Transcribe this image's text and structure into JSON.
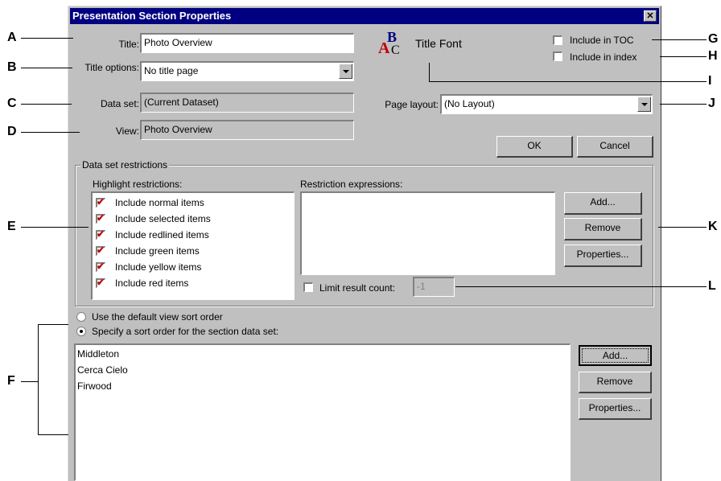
{
  "dialog": {
    "title": "Presentation Section Properties",
    "close_glyph": "✕",
    "title_label": "Title:",
    "title_value": "Photo Overview",
    "title_options_label": "Title options:",
    "title_options_value": "No title page",
    "dataset_label": "Data set:",
    "dataset_value": "(Current Dataset)",
    "view_label": "View:",
    "view_value": "Photo Overview",
    "title_font_label": "Title Font",
    "include_toc_label": "Include in TOC",
    "include_index_label": "Include in index",
    "page_layout_label": "Page layout:",
    "page_layout_value": "(No Layout)",
    "ok_label": "OK",
    "cancel_label": "Cancel"
  },
  "restrictions": {
    "group_label": "Data set restrictions",
    "highlight_label": "Highlight restrictions:",
    "highlight_items": [
      {
        "label": "Include normal items",
        "checked": true
      },
      {
        "label": "Include selected items",
        "checked": true
      },
      {
        "label": "Include redlined items",
        "checked": true
      },
      {
        "label": "Include green items",
        "checked": true
      },
      {
        "label": "Include yellow items",
        "checked": true
      },
      {
        "label": "Include red items",
        "checked": true
      }
    ],
    "expressions_label": "Restriction expressions:",
    "add_label": "Add...",
    "remove_label": "Remove",
    "properties_label": "Properties...",
    "limit_label": "Limit result count:",
    "limit_value": "-1"
  },
  "sort": {
    "default_label": "Use the default view sort order",
    "specify_label": "Specify a sort order for the section data set:",
    "items": [
      "Middleton",
      "Cerca Cielo",
      "Firwood"
    ],
    "add_label": "Add...",
    "remove_label": "Remove",
    "properties_label": "Properties..."
  },
  "callouts": {
    "A": "A",
    "B": "B",
    "C": "C",
    "D": "D",
    "E": "E",
    "F": "F",
    "G": "G",
    "H": "H",
    "I": "I",
    "J": "J",
    "K": "K",
    "L": "L"
  },
  "colors": {
    "titlebar": "#000080",
    "dialog_face": "#c0c0c0",
    "check_mark": "#c00000"
  }
}
